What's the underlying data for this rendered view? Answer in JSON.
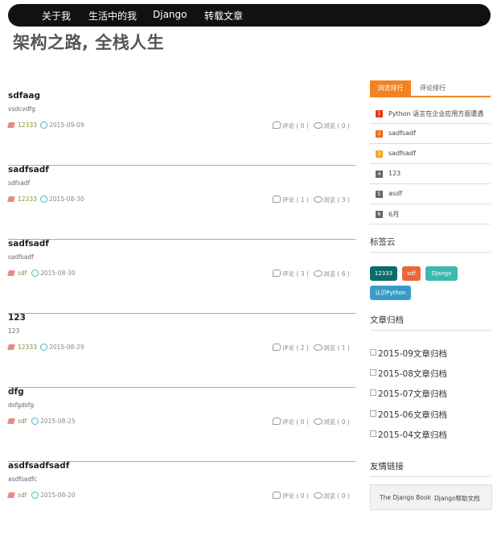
{
  "nav": {
    "items": [
      "关于我",
      "生活中的我",
      "Django",
      "转载文章"
    ]
  },
  "site": {
    "title": "架构之路, 全栈人生"
  },
  "posts": [
    {
      "title": "sdfaag",
      "summary": "vsdcvdfg",
      "tag": "12333",
      "date": "2015-09-09",
      "comments": "评论 ( 0 )",
      "views": "浏览 ( 0 )"
    },
    {
      "title": "sadfsadf",
      "summary": "sdfsadf",
      "tag": "12333",
      "date": "2015-08-30",
      "comments": "评论 ( 1 )",
      "views": "浏览 ( 3 )"
    },
    {
      "title": "sadfsadf",
      "summary": "sadfsadf",
      "tag": "sdf",
      "date": "2015-08-30",
      "comments": "评论 ( 3 )",
      "views": "浏览 ( 6 )"
    },
    {
      "title": "123",
      "summary": "123",
      "tag": "12333",
      "date": "2015-08-29",
      "comments": "评论 ( 2 )",
      "views": "浏览 ( 1 )"
    },
    {
      "title": "dfg",
      "summary": "dsfgdsfg",
      "tag": "sdf",
      "date": "2015-08-25",
      "comments": "评论 ( 0 )",
      "views": "浏览 ( 0 )"
    },
    {
      "title": "asdfsadfsadf",
      "summary": "asdfsadfc",
      "tag": "sdf",
      "date": "2015-08-20",
      "comments": "评论 ( 0 )",
      "views": "浏览 ( 0 )"
    }
  ],
  "sidebar": {
    "tabs": [
      "浏览排行",
      "评论排行"
    ],
    "ranking": [
      {
        "num": "1",
        "title": "Python 语言在企业应用方面遭遇",
        "color": "#e8380d"
      },
      {
        "num": "2",
        "title": "sadfsadf",
        "color": "#f06b10"
      },
      {
        "num": "3",
        "title": "sadfsadf",
        "color": "#f5a623"
      },
      {
        "num": "4",
        "title": "123",
        "color": "#666666"
      },
      {
        "num": "5",
        "title": "asdf",
        "color": "#666666"
      },
      {
        "num": "6",
        "title": "6月",
        "color": "#666666"
      }
    ],
    "tag_cloud_title": "标签云",
    "tag_cloud": [
      {
        "label": "12333",
        "color": "#0b6b6b"
      },
      {
        "label": "sdf",
        "color": "#e8673c"
      },
      {
        "label": "Django",
        "color": "#3bb8b0"
      },
      {
        "label": "认识Python",
        "color": "#3a9cc4"
      }
    ],
    "archive_title": "文章归档",
    "archives": [
      "2015-09文章归档",
      "2015-08文章归档",
      "2015-07文章归档",
      "2015-06文章归档",
      "2015-04文章归档"
    ],
    "links_title": "友情链接",
    "links": [
      "The Django Book",
      "Django帮助文档"
    ]
  },
  "icons": {
    "tag": "tag-icon",
    "clock": "clock-icon",
    "comment": "comment-icon",
    "views": "eye-icon",
    "archive": "archive-icon"
  }
}
